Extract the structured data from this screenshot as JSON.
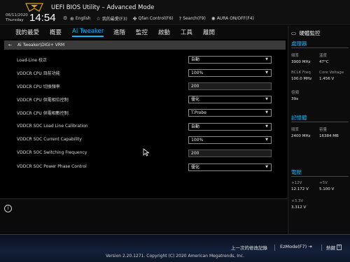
{
  "header": {
    "title": "UEFI BIOS Utility – Advanced Mode",
    "date": "06/11/2020",
    "day": "Thursday",
    "time": "14:54",
    "shortcuts": [
      {
        "label": "English",
        "icon": "globe-icon"
      },
      {
        "label": "我的最愛(F3)",
        "icon": "star-icon"
      },
      {
        "label": "Qfan Control(F6)",
        "icon": "fan-icon"
      },
      {
        "label": "Search(F9)",
        "icon": "question-icon"
      },
      {
        "label": "AURA ON/OFF(F4)",
        "icon": "aura-icon"
      }
    ]
  },
  "menu": {
    "items": [
      "我的最愛",
      "概要",
      "Ai Tweaker",
      "進階",
      "監控",
      "啟動",
      "工具",
      "離開"
    ],
    "active": "Ai Tweaker"
  },
  "breadcrumb": "Ai Tweaker\\DIGI+ VRM",
  "settings": [
    {
      "label": "Load-Line 校正",
      "value": "自動",
      "type": "select"
    },
    {
      "label": "VDDCR CPU 目前功能",
      "value": "100%",
      "type": "select"
    },
    {
      "label": "VDDCR CPU 切換頻率",
      "value": "200",
      "type": "input"
    },
    {
      "label": "VDDCR CPU 供電相位控制",
      "value": "優化",
      "type": "select"
    },
    {
      "label": "VDDCR CPU 供電相數控制",
      "value": "T.Probe",
      "type": "select"
    },
    {
      "label": "VDDCR SOC Load Line Calibration",
      "value": "自動",
      "type": "select"
    },
    {
      "label": "VDDCR SOC Current Capability",
      "value": "100%",
      "type": "select"
    },
    {
      "label": "VDDCR SOC Switching Frequency",
      "value": "200",
      "type": "input"
    },
    {
      "label": "VDDCR SOC Power Phase Control",
      "value": "優化",
      "type": "select"
    }
  ],
  "monitor": {
    "title": "硬體監控",
    "sections": [
      {
        "title": "處理器",
        "items": [
          {
            "key": "頻率",
            "value": "3900 MHz"
          },
          {
            "key": "溫度",
            "value": "47°C"
          },
          {
            "key": "BCLK Freq",
            "value": "100.0 MHz"
          },
          {
            "key": "Core Voltage",
            "value": "1.456 V"
          },
          {
            "key": "倍頻",
            "value": "39x"
          }
        ]
      },
      {
        "title": "記憶體",
        "items": [
          {
            "key": "頻率",
            "value": "2400 MHz"
          },
          {
            "key": "容量",
            "value": "16384 MB"
          }
        ]
      },
      {
        "title": "電壓",
        "items": [
          {
            "key": "+12V",
            "value": "12.172 V"
          },
          {
            "key": "+5V",
            "value": "5.100 V"
          },
          {
            "key": "+3.3V",
            "value": "3.312 V"
          }
        ]
      }
    ]
  },
  "footer": {
    "last_modified": "上一次的修改記錄",
    "ezmode": "EzMode(F7)",
    "hotkeys": "熱鍵",
    "hotkey_key": "?",
    "version": "Version 2.20.1271. Copyright (C) 2020 American Megatrends, Inc."
  },
  "colors": {
    "accent": "#0fb8ff",
    "section_title": "#12b6f5"
  }
}
